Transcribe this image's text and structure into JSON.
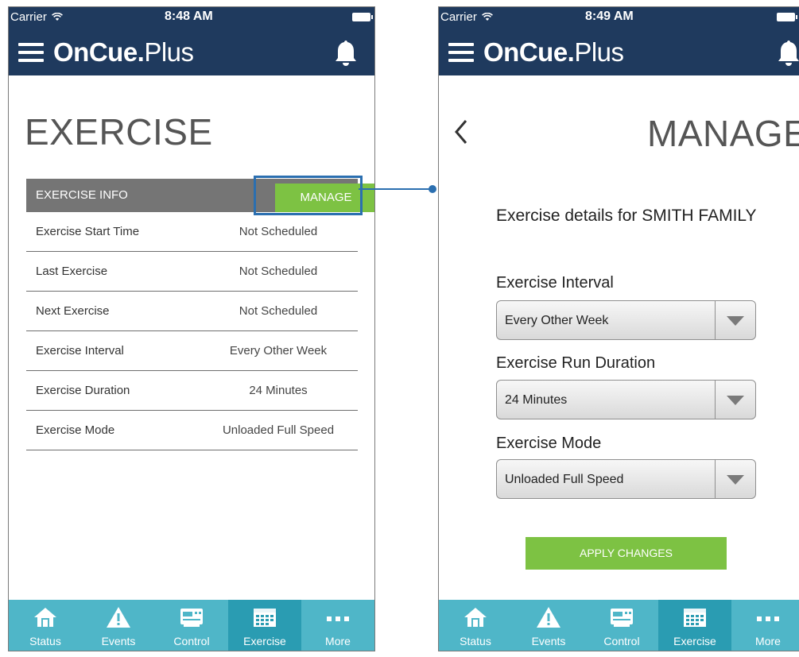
{
  "colors": {
    "header_bg": "#1f3a5e",
    "accent_green": "#7dc243",
    "tabbar_bg": "#4fb6c8",
    "tab_active_bg": "#2a9cb2",
    "info_header_bg": "#757575",
    "highlight_blue": "#2b6fb0"
  },
  "left": {
    "status": {
      "carrier": "Carrier",
      "time": "8:48 AM"
    },
    "brand": {
      "oncue": "OnCue",
      "dot": ".",
      "plus": "Plus"
    },
    "page_title": "EXERCISE",
    "info_header": {
      "label": "EXERCISE INFO",
      "manage_label": "MANAGE"
    },
    "rows": [
      {
        "label": "Exercise Start Time",
        "value": "Not Scheduled"
      },
      {
        "label": "Last Exercise",
        "value": "Not Scheduled"
      },
      {
        "label": "Next Exercise",
        "value": "Not Scheduled"
      },
      {
        "label": "Exercise Interval",
        "value": "Every Other Week"
      },
      {
        "label": "Exercise Duration",
        "value": "24 Minutes"
      },
      {
        "label": "Exercise Mode",
        "value": "Unloaded Full Speed"
      }
    ]
  },
  "right": {
    "status": {
      "carrier": "Carrier",
      "time": "8:49 AM"
    },
    "brand": {
      "oncue": "OnCue",
      "dot": ".",
      "plus": "Plus"
    },
    "page_title": "MANAGE",
    "details_title": "Exercise details for SMITH FAMILY",
    "interval": {
      "label": "Exercise Interval",
      "value": "Every Other Week"
    },
    "duration": {
      "label": "Exercise Run Duration",
      "value": "24 Minutes"
    },
    "mode": {
      "label": "Exercise Mode",
      "value": "Unloaded Full Speed"
    },
    "apply_label": "APPLY CHANGES"
  },
  "tabs": [
    {
      "label": "Status",
      "icon": "home-icon"
    },
    {
      "label": "Events",
      "icon": "warning-icon"
    },
    {
      "label": "Control",
      "icon": "control-panel-icon"
    },
    {
      "label": "Exercise",
      "icon": "calendar-icon",
      "active": true
    },
    {
      "label": "More",
      "icon": "more-dots-icon"
    }
  ]
}
